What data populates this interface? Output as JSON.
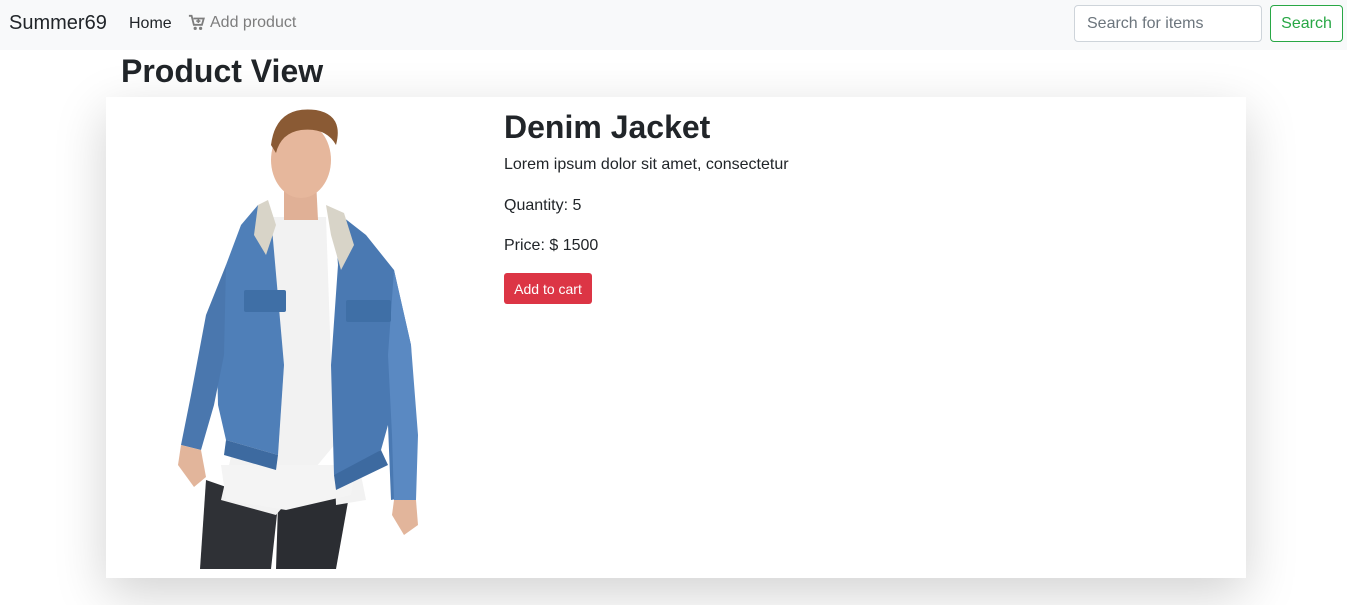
{
  "navbar": {
    "brand": "Summer69",
    "home_label": "Home",
    "add_product_label": "Add product",
    "search_placeholder": "Search for items",
    "search_button": "Search"
  },
  "page": {
    "title": "Product View"
  },
  "product": {
    "name": "Denim Jacket",
    "description": "Lorem ipsum dolor sit amet, consectetur",
    "quantity_label": "Quantity:",
    "quantity": "5",
    "price_label": "Price:",
    "price": "$ 1500",
    "add_to_cart": "Add to cart"
  },
  "colors": {
    "navbar_bg": "#f8f9fa",
    "search_green": "#28a745",
    "cart_red": "#dc3545",
    "denim": "#4f7fb8"
  },
  "icons": {
    "add_product": "cart-plus-icon"
  }
}
